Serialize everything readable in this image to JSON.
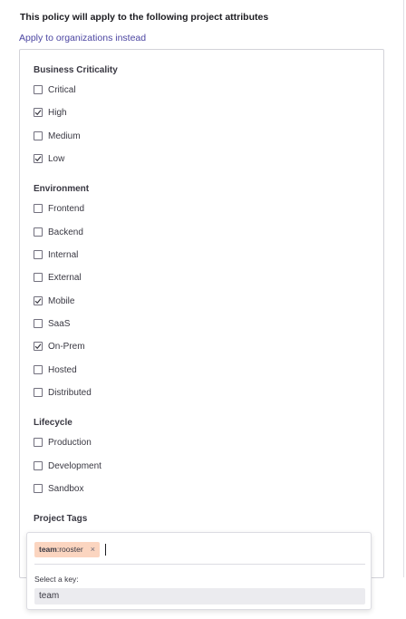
{
  "heading": "This policy will apply to the following project attributes",
  "link": "Apply to organizations instead",
  "groups": [
    {
      "title": "Business Criticality",
      "options": [
        {
          "label": "Critical",
          "checked": false
        },
        {
          "label": "High",
          "checked": true
        },
        {
          "label": "Medium",
          "checked": false
        },
        {
          "label": "Low",
          "checked": true
        }
      ]
    },
    {
      "title": "Environment",
      "options": [
        {
          "label": "Frontend",
          "checked": false
        },
        {
          "label": "Backend",
          "checked": false
        },
        {
          "label": "Internal",
          "checked": false
        },
        {
          "label": "External",
          "checked": false
        },
        {
          "label": "Mobile",
          "checked": true
        },
        {
          "label": "SaaS",
          "checked": false
        },
        {
          "label": "On-Prem",
          "checked": true
        },
        {
          "label": "Hosted",
          "checked": false
        },
        {
          "label": "Distributed",
          "checked": false
        }
      ]
    },
    {
      "title": "Lifecycle",
      "options": [
        {
          "label": "Production",
          "checked": false
        },
        {
          "label": "Development",
          "checked": false
        },
        {
          "label": "Sandbox",
          "checked": false
        }
      ]
    }
  ],
  "tags": {
    "title": "Project Tags",
    "chip_key": "team",
    "chip_sep": ":",
    "chip_value": "rooster",
    "chip_remove": "×",
    "select_label": "Select a key:",
    "suggestion": "team"
  },
  "colors": {
    "link": "#4b45a1",
    "chip_bg": "#fbd5c0",
    "check": "#393842"
  }
}
